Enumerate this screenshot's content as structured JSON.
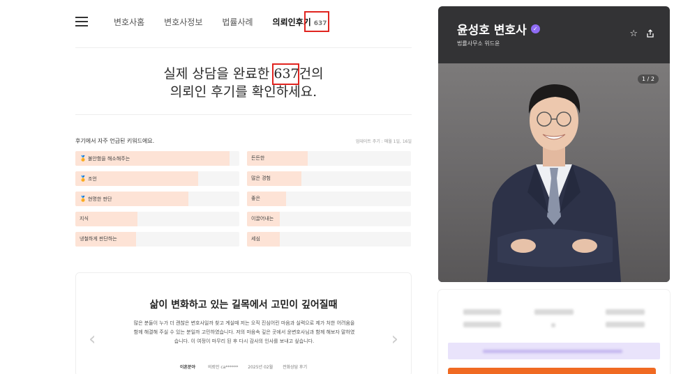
{
  "nav": {
    "tabs": [
      {
        "label": "변호사홈"
      },
      {
        "label": "변호사정보"
      },
      {
        "label": "법률사례"
      },
      {
        "label": "의뢰인후기",
        "badge": "637",
        "active": true
      }
    ]
  },
  "headline": {
    "line1_prefix": "실제 상담을 완료한 ",
    "count": "637",
    "line1_suffix": "건의",
    "line2": "의뢰인 후기를 확인하세요."
  },
  "keywords": {
    "title": "후기에서 자주 언급된 키워드에요.",
    "update_note": "업데이트 주기 : 매월 1일, 16일",
    "left": [
      {
        "label": "불안함을 해소해주는",
        "icon": "gold-medal-icon",
        "share": 0.94
      },
      {
        "label": "조언",
        "icon": "green-medal-icon",
        "share": 0.75
      },
      {
        "label": "현명한 판단",
        "icon": "bronze-medal-icon",
        "share": 0.69
      },
      {
        "label": "지식",
        "icon": "",
        "share": 0.38
      },
      {
        "label": "냉철하게 판단하는",
        "icon": "",
        "share": 0.37
      }
    ],
    "right": [
      {
        "label": "든든한",
        "share": 0.37
      },
      {
        "label": "많은 경험",
        "share": 0.33
      },
      {
        "label": "좋은",
        "share": 0.24
      },
      {
        "label": "이끌어내는",
        "share": 0.2
      },
      {
        "label": "세심",
        "share": 0.2
      }
    ]
  },
  "review": {
    "title": "삶이 변화하고 있는 길목에서 고민이 깊어질때",
    "body": "많은 분들이 누가 더 괜찮은 변호사일까 찾고 계실때 저는 오직 진심어린 마음과 실력으로 제가 처한 어려움을 함께 해결해 주실 수 있는 분일까 고민하였습니다. 저의 마음속 깊은 곳에서 윤변호사님과 함께 해보자 말하였습니다. 이 여정이 마무리 된 후 다시 감사의 인사를 보내고 싶습니다.",
    "category": "이혼분야",
    "author": "의뢰인 ca******",
    "date": "2025년 02월",
    "type": "전화상담 후기"
  },
  "profile": {
    "name": "윤성호 변호사",
    "firm": "법률사무소 위드윤",
    "photo_counter": "1 / 2"
  },
  "colors": {
    "highlight_box": "#e0241f",
    "keyword_fill": "#fde3d6",
    "verify_badge": "#8f6cf5",
    "cta_orange": "#f06a22",
    "profile_bg": "#333335"
  }
}
